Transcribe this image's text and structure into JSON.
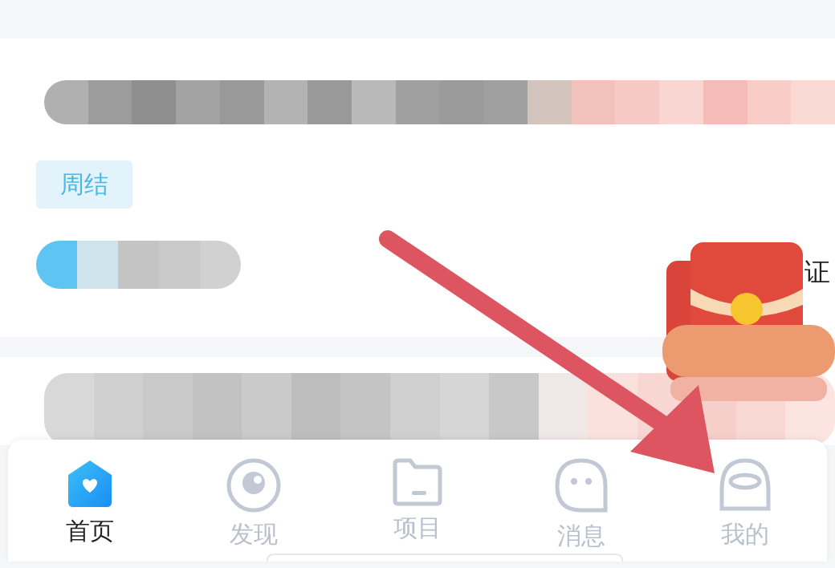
{
  "job_card": {
    "tag": "周结",
    "trailing_text": "证"
  },
  "tab_bar": {
    "tabs": [
      {
        "label": "首页",
        "selected": true
      },
      {
        "label": "发现",
        "selected": false
      },
      {
        "label": "项目",
        "selected": false
      },
      {
        "label": "消息",
        "selected": false
      },
      {
        "label": "我的",
        "selected": false
      }
    ]
  }
}
